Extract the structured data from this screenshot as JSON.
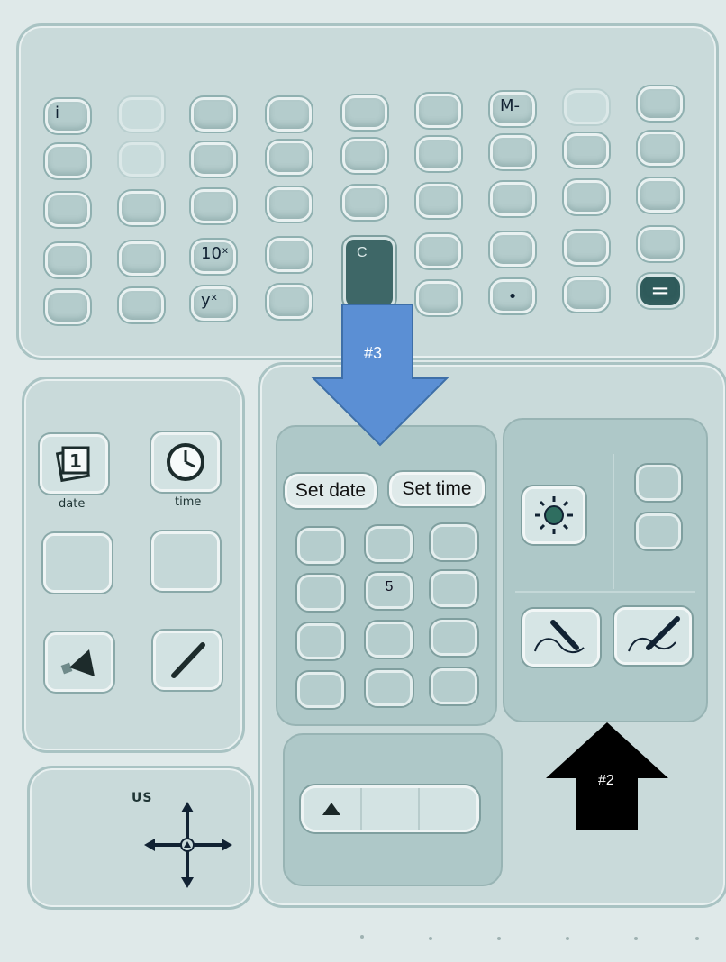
{
  "calculator": {
    "key_i": "i",
    "key_m_minus": "M-",
    "key_ten_x": "10ˣ",
    "key_y_x": "yˣ",
    "key_c": "C",
    "key_point": "•",
    "key_equals": "="
  },
  "left_panel": {
    "date_icon_number": "1",
    "date_label": "date",
    "time_label": "time"
  },
  "direction_panel": {
    "label": "US"
  },
  "keypad": {
    "set_date": "Set date",
    "set_time": "Set time",
    "key_5": "5"
  },
  "annotations": {
    "arrow3_label": "#3",
    "arrow2_label": "#2",
    "arrow3_color": "#5b8fd4",
    "arrow2_color": "#000000"
  },
  "icons": [
    "calendar-icon",
    "clock-icon",
    "speaker-icon",
    "pen-icon",
    "sun-icon",
    "hand-write-icon",
    "hand-erase-icon",
    "direction-pad-icon",
    "up-triangle-icon"
  ]
}
